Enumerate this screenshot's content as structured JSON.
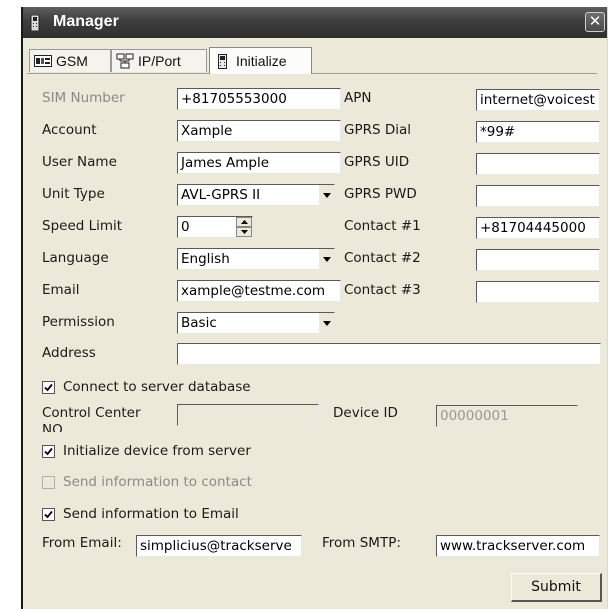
{
  "window": {
    "title": "Manager",
    "close_glyph": "✕"
  },
  "tabs": [
    {
      "label": "GSM",
      "icon": "sim-card-icon"
    },
    {
      "label": "IP/Port",
      "icon": "network-icon"
    },
    {
      "label": "Initialize",
      "icon": "device-icon",
      "active": true
    }
  ],
  "left_form": {
    "sim_number": {
      "label": "SIM Number",
      "value": "+81705553000"
    },
    "account": {
      "label": "Account",
      "value": "Xample"
    },
    "user_name": {
      "label": "User Name",
      "value": "James Ample"
    },
    "unit_type": {
      "label": "Unit Type",
      "value": "AVL-GPRS II"
    },
    "speed_limit": {
      "label": "Speed Limit",
      "value": "0"
    },
    "language": {
      "label": "Language",
      "value": "English"
    },
    "email": {
      "label": "Email",
      "value": "xample@testme.com"
    },
    "permission": {
      "label": "Permission",
      "value": "Basic"
    },
    "address": {
      "label": "Address",
      "value": ""
    }
  },
  "right_form": {
    "apn": {
      "label": "APN",
      "value": "internet@voicest"
    },
    "gprs_dial": {
      "label": "GPRS Dial",
      "value": "*99#"
    },
    "gprs_uid": {
      "label": "GPRS UID",
      "value": ""
    },
    "gprs_pwd": {
      "label": "GPRS PWD",
      "value": ""
    },
    "contact1": {
      "label": "Contact #1",
      "value": "+81704445000"
    },
    "contact2": {
      "label": "Contact #2",
      "value": ""
    },
    "contact3": {
      "label": "Contact #3",
      "value": ""
    }
  },
  "server": {
    "connect_label": "Connect to server database",
    "connect_checked": true,
    "control_center_label": "Control Center",
    "control_center_label_cut": "NO",
    "control_center_value": "",
    "device_id_label": "Device ID",
    "device_id_value": "00000001"
  },
  "options": {
    "init_label": "Initialize device from server",
    "init_checked": true,
    "send_contact_label": "Send information to contact",
    "send_contact_checked": false,
    "send_email_label": "Send information to Email",
    "send_email_checked": true,
    "from_email_label": "From Email:",
    "from_email_value": "simplicius@trackserve",
    "from_smtp_label": "From SMTP:",
    "from_smtp_value": "www.trackserver.com"
  },
  "submit_label": "Submit",
  "colors": {
    "dialog_bg": "#ece9d8",
    "titlebar": "#3e3e3e",
    "disabled_text": "#8a8a8a"
  }
}
